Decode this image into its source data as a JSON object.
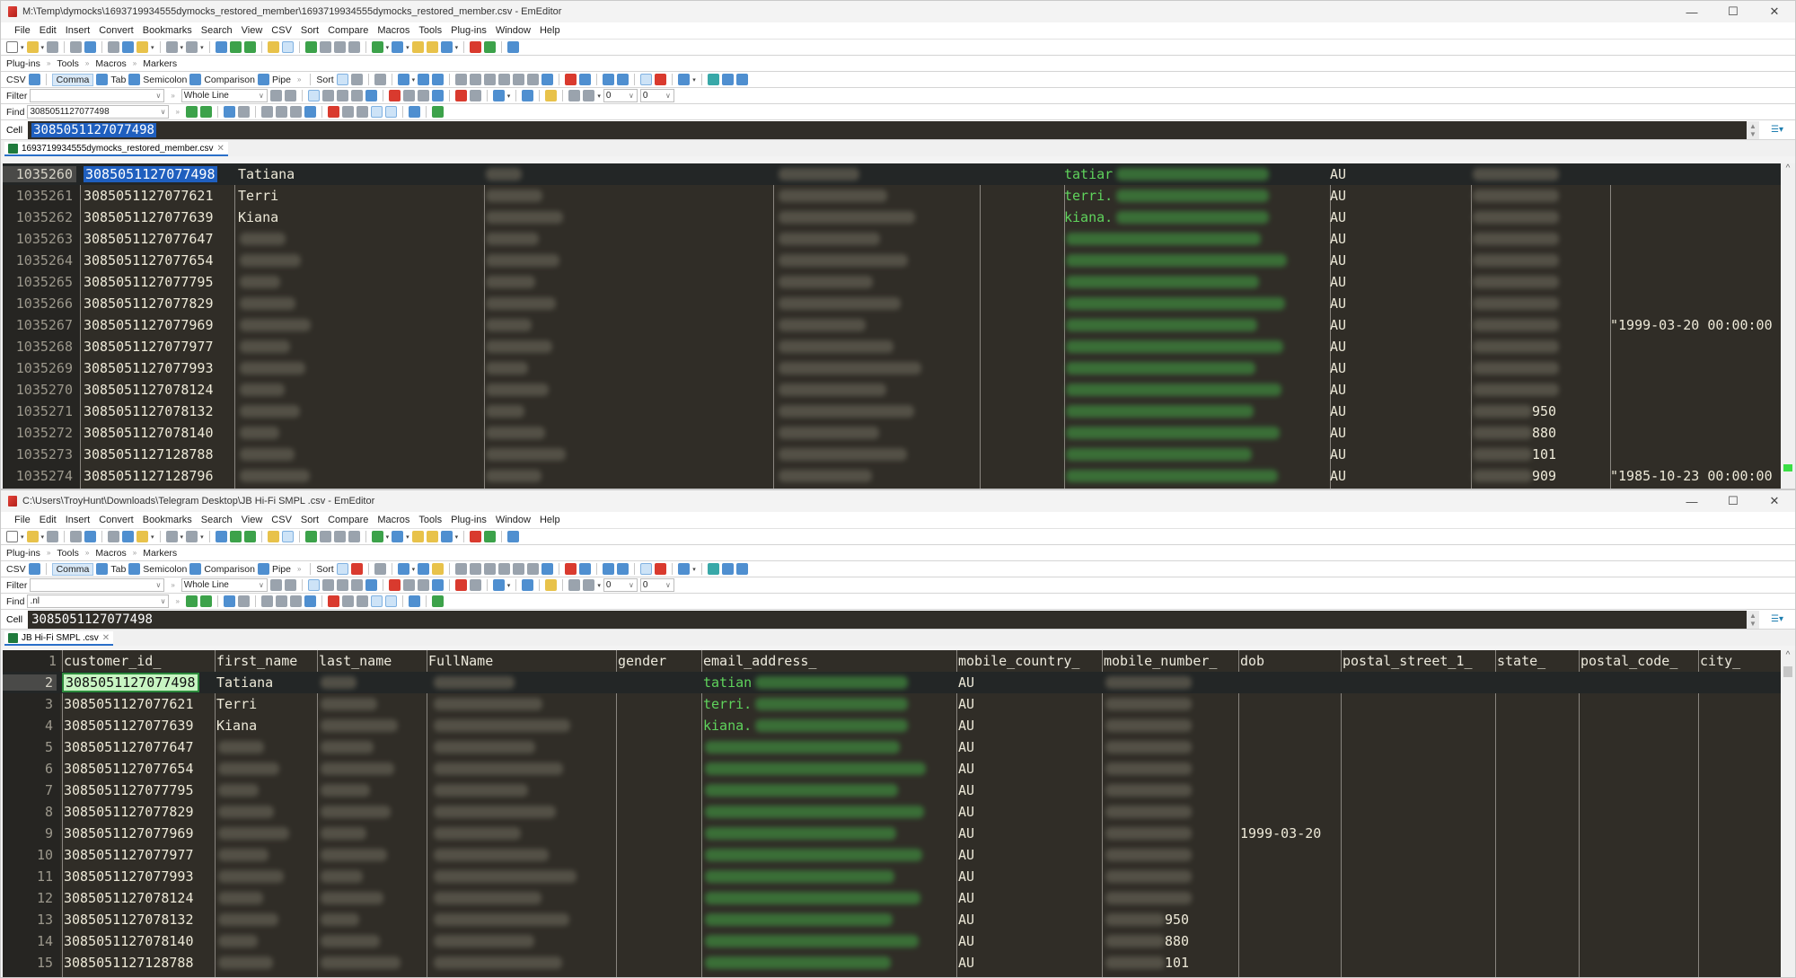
{
  "window1": {
    "title": "M:\\Temp\\dymocks\\1693719934555dymocks_restored_member\\1693719934555dymocks_restored_member.csv - EmEditor",
    "menu": [
      "File",
      "Edit",
      "Insert",
      "Convert",
      "Bookmarks",
      "Search",
      "View",
      "CSV",
      "Sort",
      "Compare",
      "Macros",
      "Tools",
      "Plug-ins",
      "Window",
      "Help"
    ],
    "toolbars": [
      "Plug-ins",
      "Tools",
      "Macros",
      "Markers"
    ],
    "csv_bar": {
      "csv": "CSV",
      "modes": [
        "Comma",
        "Tab",
        "Semicolon",
        "Comparison",
        "Pipe"
      ],
      "active": "Comma",
      "sort": "Sort"
    },
    "filter": {
      "label": "Filter",
      "value": "",
      "mode": "Whole Line",
      "num1": "0",
      "num2": "0"
    },
    "find": {
      "label": "Find",
      "value": "3085051127077498"
    },
    "cell": {
      "label": "Cell",
      "value": "3085051127077498"
    },
    "tab": "1693719934555dymocks_restored_member.csv",
    "rows": [
      {
        "ln": "1035260",
        "id": "3085051127077498",
        "first": "Tatiana",
        "email": "tatiar",
        "country": "AU",
        "mobile_tail": "",
        "dob": ""
      },
      {
        "ln": "1035261",
        "id": "3085051127077621",
        "first": "Terri",
        "email": "terri.",
        "country": "AU",
        "mobile_tail": "",
        "dob": ""
      },
      {
        "ln": "1035262",
        "id": "3085051127077639",
        "first": "Kiana",
        "email": "kiana.",
        "country": "AU",
        "mobile_tail": "",
        "dob": ""
      },
      {
        "ln": "1035263",
        "id": "3085051127077647",
        "first": "",
        "email": "",
        "country": "AU",
        "mobile_tail": "",
        "dob": ""
      },
      {
        "ln": "1035264",
        "id": "3085051127077654",
        "first": "",
        "email": "",
        "country": "AU",
        "mobile_tail": "",
        "dob": ""
      },
      {
        "ln": "1035265",
        "id": "3085051127077795",
        "first": "",
        "email": "",
        "country": "AU",
        "mobile_tail": "",
        "dob": ""
      },
      {
        "ln": "1035266",
        "id": "3085051127077829",
        "first": "",
        "email": "",
        "country": "AU",
        "mobile_tail": "",
        "dob": ""
      },
      {
        "ln": "1035267",
        "id": "3085051127077969",
        "first": "",
        "email": "",
        "country": "AU",
        "mobile_tail": "",
        "dob": "\"1999-03-20 00:00:00"
      },
      {
        "ln": "1035268",
        "id": "3085051127077977",
        "first": "",
        "email": "",
        "country": "AU",
        "mobile_tail": "",
        "dob": ""
      },
      {
        "ln": "1035269",
        "id": "3085051127077993",
        "first": "",
        "email": "",
        "country": "AU",
        "mobile_tail": "",
        "dob": ""
      },
      {
        "ln": "1035270",
        "id": "3085051127078124",
        "first": "",
        "email": "",
        "country": "AU",
        "mobile_tail": "",
        "dob": ""
      },
      {
        "ln": "1035271",
        "id": "3085051127078132",
        "first": "",
        "email": "",
        "country": "AU",
        "mobile_tail": "950",
        "dob": ""
      },
      {
        "ln": "1035272",
        "id": "3085051127078140",
        "first": "",
        "email": "",
        "country": "AU",
        "mobile_tail": "880",
        "dob": ""
      },
      {
        "ln": "1035273",
        "id": "3085051127128788",
        "first": "",
        "email": "",
        "country": "AU",
        "mobile_tail": "101",
        "dob": ""
      },
      {
        "ln": "1035274",
        "id": "3085051127128796",
        "first": "",
        "email": "",
        "country": "AU",
        "mobile_tail": "909",
        "dob": "\"1985-10-23 00:00:00"
      }
    ]
  },
  "window2": {
    "title": "C:\\Users\\TroyHunt\\Downloads\\Telegram Desktop\\JB Hi-Fi SMPL .csv - EmEditor",
    "menu": [
      "File",
      "Edit",
      "Insert",
      "Convert",
      "Bookmarks",
      "Search",
      "View",
      "CSV",
      "Sort",
      "Compare",
      "Macros",
      "Tools",
      "Plug-ins",
      "Window",
      "Help"
    ],
    "toolbars": [
      "Plug-ins",
      "Tools",
      "Macros",
      "Markers"
    ],
    "csv_bar": {
      "csv": "CSV",
      "modes": [
        "Comma",
        "Tab",
        "Semicolon",
        "Comparison",
        "Pipe"
      ],
      "active": "Comma",
      "sort": "Sort"
    },
    "filter": {
      "label": "Filter",
      "value": "",
      "mode": "Whole Line",
      "num1": "0",
      "num2": "0"
    },
    "find": {
      "label": "Find",
      "value": ".nl"
    },
    "cell": {
      "label": "Cell",
      "value": "3085051127077498"
    },
    "tab": "JB Hi-Fi SMPL .csv",
    "headers": [
      "customer_id_",
      "first_name",
      "last_name",
      "FullName",
      "gender",
      "email_address_",
      "mobile_country_",
      "mobile_number_",
      "dob",
      "postal_street_1_",
      "state_",
      "postal_code_",
      "city_"
    ],
    "rows": [
      {
        "ln": "2",
        "id": "3085051127077498",
        "first": "Tatiana",
        "email": "tatian",
        "country": "AU",
        "mobile_tail": "",
        "dob": ""
      },
      {
        "ln": "3",
        "id": "3085051127077621",
        "first": "Terri",
        "email": "terri.",
        "country": "AU",
        "mobile_tail": "",
        "dob": ""
      },
      {
        "ln": "4",
        "id": "3085051127077639",
        "first": "Kiana",
        "email": "kiana.",
        "country": "AU",
        "mobile_tail": "",
        "dob": ""
      },
      {
        "ln": "5",
        "id": "3085051127077647",
        "first": "",
        "email": "",
        "country": "AU",
        "mobile_tail": "",
        "dob": ""
      },
      {
        "ln": "6",
        "id": "3085051127077654",
        "first": "",
        "email": "",
        "country": "AU",
        "mobile_tail": "",
        "dob": ""
      },
      {
        "ln": "7",
        "id": "3085051127077795",
        "first": "",
        "email": "",
        "country": "AU",
        "mobile_tail": "",
        "dob": ""
      },
      {
        "ln": "8",
        "id": "3085051127077829",
        "first": "",
        "email": "",
        "country": "AU",
        "mobile_tail": "",
        "dob": ""
      },
      {
        "ln": "9",
        "id": "3085051127077969",
        "first": "",
        "email": "",
        "country": "AU",
        "mobile_tail": "",
        "dob": "1999-03-20"
      },
      {
        "ln": "10",
        "id": "3085051127077977",
        "first": "",
        "email": "",
        "country": "AU",
        "mobile_tail": "",
        "dob": ""
      },
      {
        "ln": "11",
        "id": "3085051127077993",
        "first": "",
        "email": "",
        "country": "AU",
        "mobile_tail": "",
        "dob": ""
      },
      {
        "ln": "12",
        "id": "3085051127078124",
        "first": "",
        "email": "",
        "country": "AU",
        "mobile_tail": "",
        "dob": ""
      },
      {
        "ln": "13",
        "id": "3085051127078132",
        "first": "",
        "email": "",
        "country": "AU",
        "mobile_tail": "950",
        "dob": ""
      },
      {
        "ln": "14",
        "id": "3085051127078140",
        "first": "",
        "email": "",
        "country": "AU",
        "mobile_tail": "880",
        "dob": ""
      },
      {
        "ln": "15",
        "id": "3085051127128788",
        "first": "",
        "email": "",
        "country": "AU",
        "mobile_tail": "101",
        "dob": ""
      }
    ]
  },
  "icons": {
    "minimize": "—",
    "maximize": "☐",
    "close": "✕",
    "overflow": "»",
    "dropdown": "▾"
  }
}
